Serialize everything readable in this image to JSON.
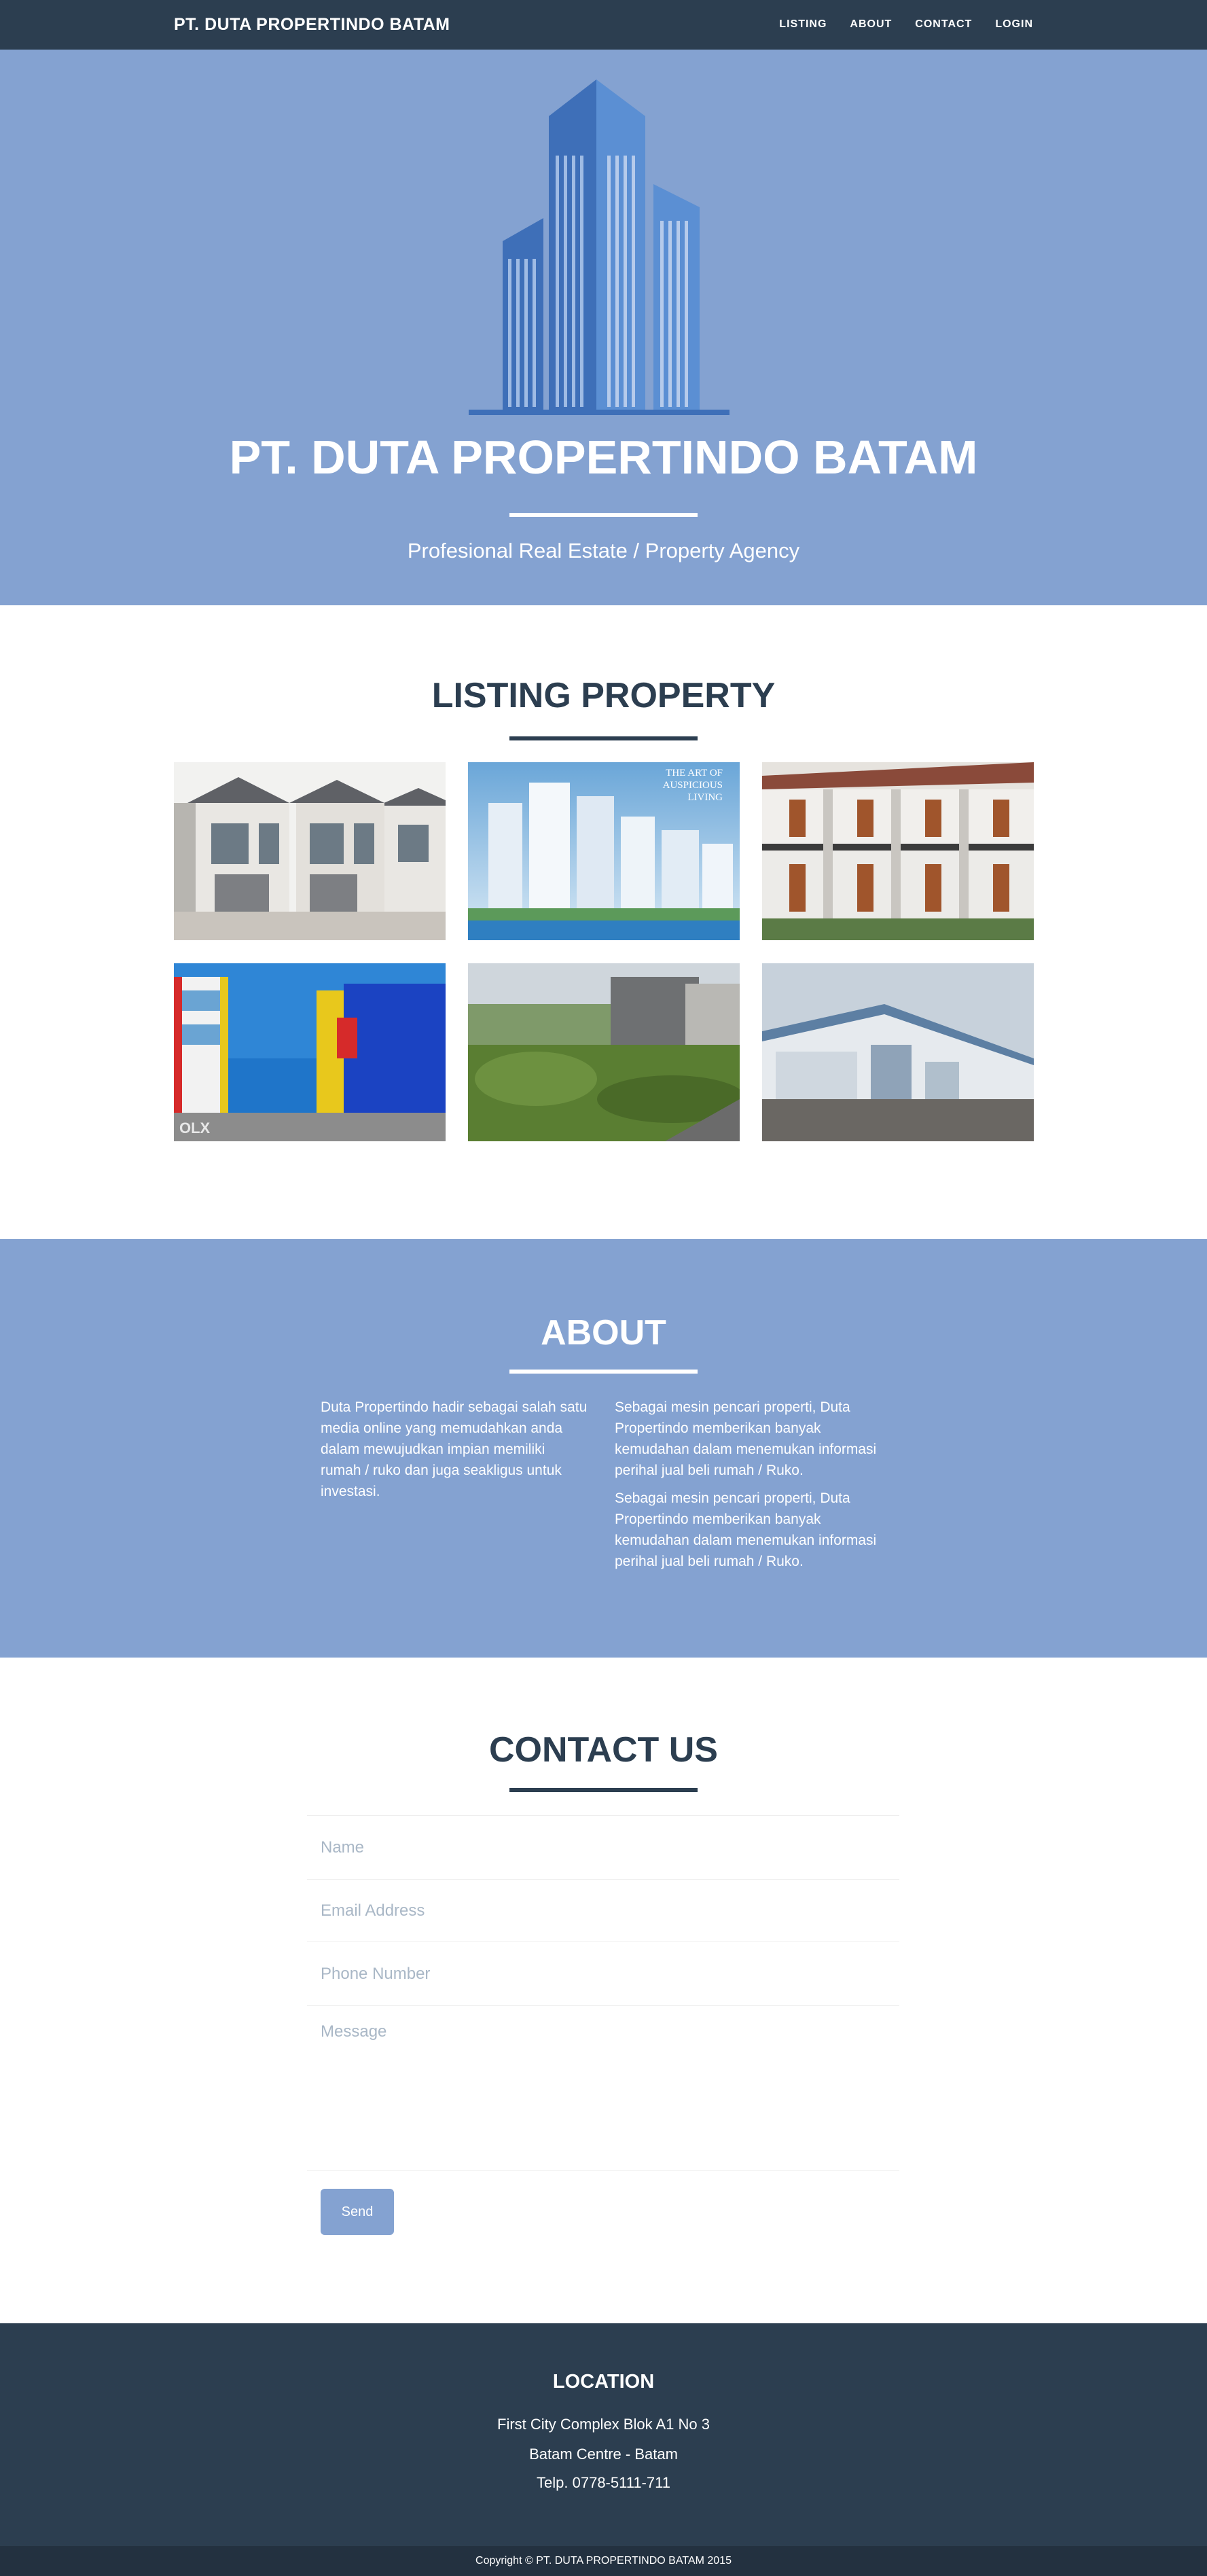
{
  "nav": {
    "brand": "PT. DUTA PROPERTINDO BATAM",
    "links": [
      "LISTING",
      "ABOUT",
      "CONTACT",
      "LOGIN"
    ]
  },
  "hero": {
    "title": "PT. DUTA PROPERTINDO BATAM",
    "subtitle": "Profesional Real Estate / Property Agency"
  },
  "listing": {
    "title": "LISTING PROPERTY",
    "items": [
      {
        "image": "townhouse-photo"
      },
      {
        "image": "apartment-towers-photo",
        "caption_lines": [
          "THE ART OF",
          "AUSPICIOUS",
          "LIVING"
        ]
      },
      {
        "image": "row-houses-photo"
      },
      {
        "image": "ruko-shophouses-photo",
        "watermark": "OLX"
      },
      {
        "image": "empty-land-photo"
      },
      {
        "image": "warehouse-photo"
      }
    ]
  },
  "about": {
    "title": "ABOUT",
    "left": "Duta Propertindo hadir sebagai salah satu media online yang memudahkan anda dalam mewujudkan impian memiliki rumah / ruko dan juga seakligus untuk investasi.",
    "right_1": "Sebagai mesin pencari properti, Duta Propertindo memberikan banyak kemudahan dalam menemukan informasi perihal jual beli rumah / Ruko.",
    "right_2": "Sebagai mesin pencari properti, Duta Propertindo memberikan banyak kemudahan dalam menemukan informasi perihal jual beli rumah / Ruko."
  },
  "contact": {
    "title": "CONTACT US",
    "name_placeholder": "Name",
    "email_placeholder": "Email Address",
    "phone_placeholder": "Phone Number",
    "message_placeholder": "Message",
    "send_label": "Send"
  },
  "footer": {
    "title": "LOCATION",
    "address_1": "First City Complex Blok A1 No 3",
    "address_2": "Batam Centre - Batam",
    "phone": "Telp. 0778-5111-711",
    "copyright": "Copyright © PT. DUTA PROPERTINDO BATAM 2015"
  },
  "colors": {
    "navy": "#2c3e50",
    "accent_blue": "#84a2d1",
    "building_blue": "#4a7cc4"
  }
}
